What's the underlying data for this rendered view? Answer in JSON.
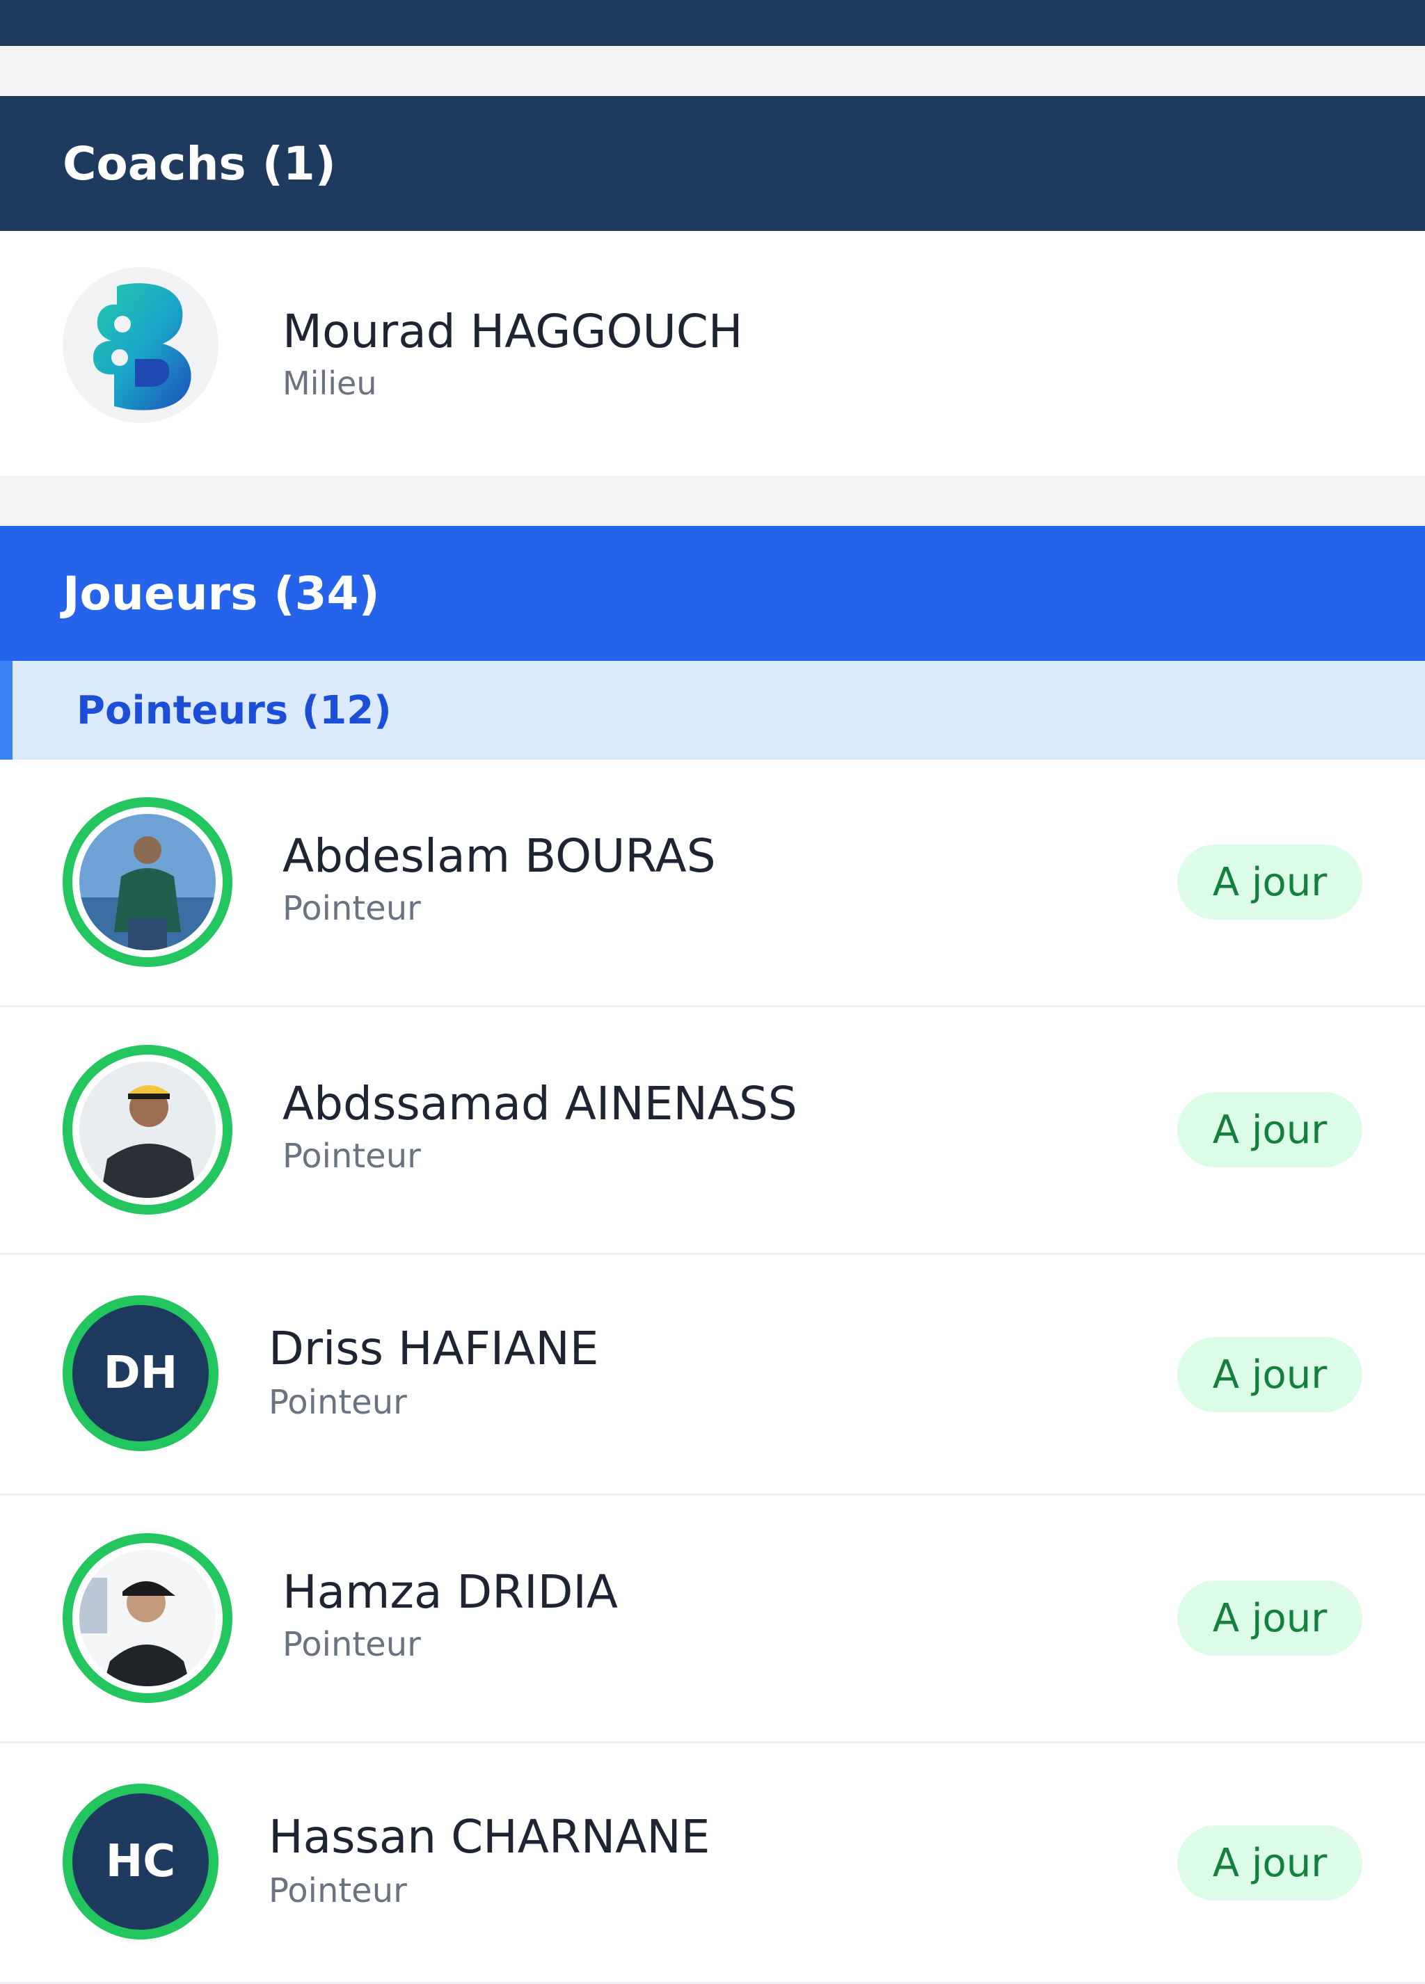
{
  "coaches": {
    "header": "Coachs (1)",
    "items": [
      {
        "name": "Mourad HAGGOUCH",
        "role": "Milieu",
        "avatar": "club-logo"
      }
    ]
  },
  "players": {
    "header": "Joueurs (34)",
    "group": {
      "label": "Pointeurs (12)"
    },
    "items": [
      {
        "name": "Abdeslam BOURAS",
        "role": "Pointeur",
        "status": "A jour",
        "avatar": "photo"
      },
      {
        "name": "Abdssamad AINENASS",
        "role": "Pointeur",
        "status": "A jour",
        "avatar": "photo"
      },
      {
        "name": "Driss HAFIANE",
        "role": "Pointeur",
        "status": "A jour",
        "initials": "DH"
      },
      {
        "name": "Hamza DRIDIA",
        "role": "Pointeur",
        "status": "A jour",
        "avatar": "photo"
      },
      {
        "name": "Hassan CHARNANE",
        "role": "Pointeur",
        "status": "A jour",
        "initials": "HC"
      }
    ]
  },
  "colors": {
    "navy": "#1f3a5f",
    "blue": "#2563eb",
    "light_blue": "#dbeafe",
    "status_green": "#22c55e",
    "badge_bg": "#dcfce7",
    "badge_text": "#15803d"
  }
}
